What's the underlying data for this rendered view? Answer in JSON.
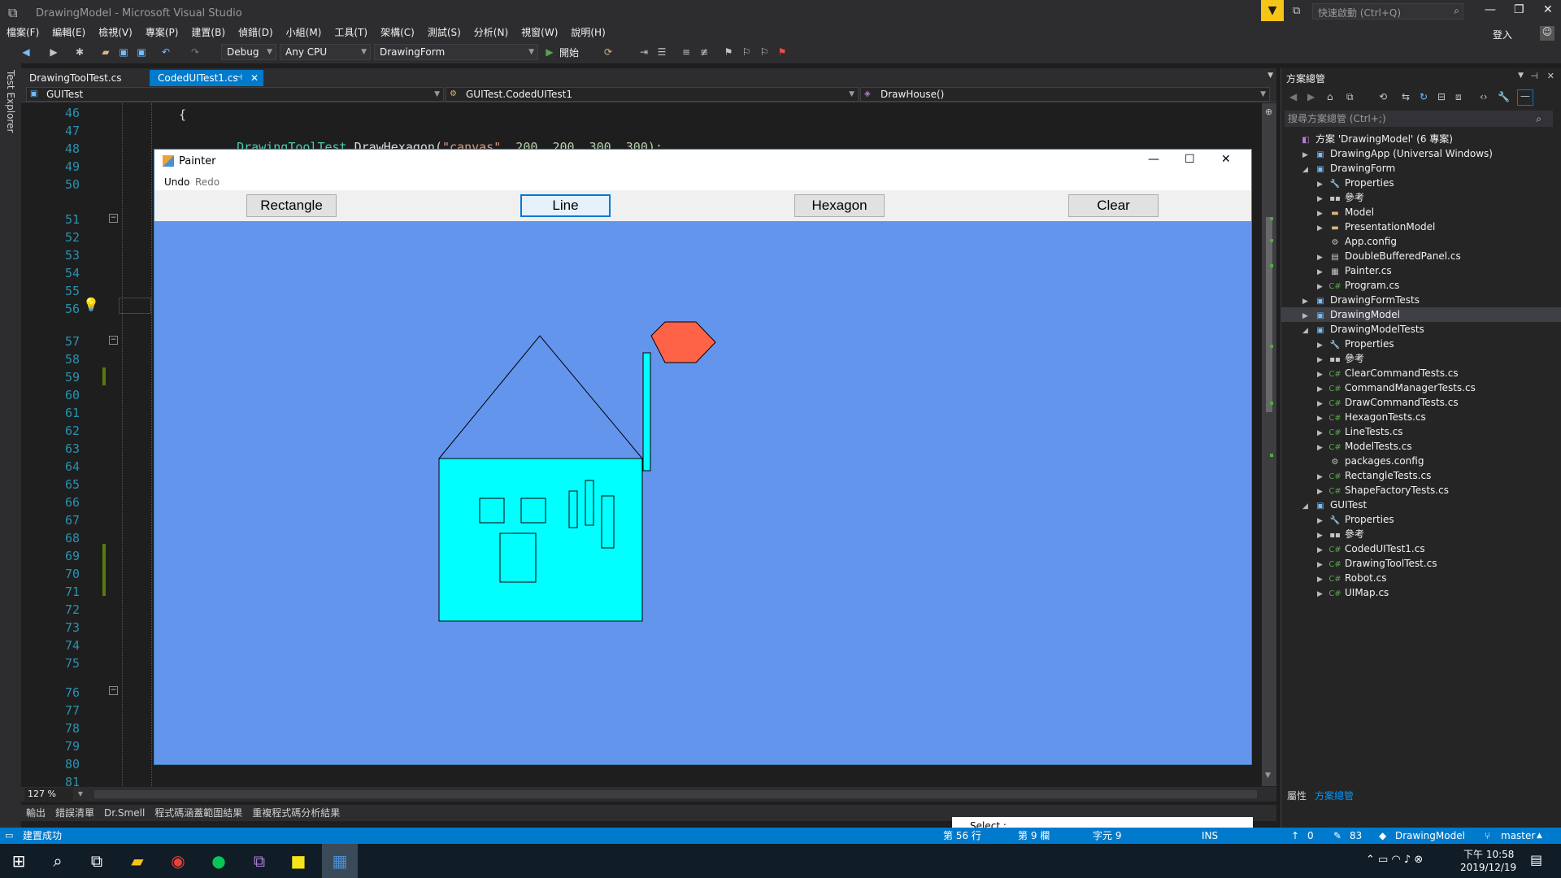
{
  "window": {
    "title": "DrawingModel - Microsoft Visual Studio",
    "quick_launch_placeholder": "快速啟動 (Ctrl+Q)",
    "signin": "登入"
  },
  "menu": [
    "檔案(F)",
    "編輯(E)",
    "檢視(V)",
    "專案(P)",
    "建置(B)",
    "偵錯(D)",
    "小組(M)",
    "工具(T)",
    "架構(C)",
    "測試(S)",
    "分析(N)",
    "視窗(W)",
    "說明(H)"
  ],
  "toolbar": {
    "config": "Debug",
    "platform": "Any CPU",
    "startup": "DrawingForm",
    "start_label": "開始"
  },
  "leftstrip": {
    "label": "Test Explorer"
  },
  "tabs": [
    {
      "label": "DrawingToolTest.cs"
    },
    {
      "label": "CodedUITest1.cs"
    }
  ],
  "nav": {
    "project": "GUITest",
    "class": "GUITest.CodedUITest1",
    "member": "DrawHouse()"
  },
  "editor": {
    "line_numbers": [
      "46",
      "47",
      "48",
      "49",
      "50",
      "51",
      "52",
      "53",
      "54",
      "55",
      "56",
      "57",
      "58",
      "59",
      "60",
      "61",
      "62",
      "63",
      "64",
      "65",
      "66",
      "67",
      "68",
      "69",
      "70",
      "71",
      "72",
      "73",
      "74",
      "75",
      "76",
      "77",
      "78",
      "79",
      "80",
      "81"
    ],
    "code": {
      "brace": "{",
      "class_name": "DrawingToolTest",
      "method_call": ".DrawHexagon(",
      "arg_string": "\"canvas\"",
      "args_rest": ", 200, 200, 300, 300);"
    },
    "zoom": "127 %"
  },
  "bottom_tabs": [
    "輸出",
    "錯誤清單",
    "Dr.Smell",
    "程式碼涵蓋範圍結果",
    "重複程式碼分析結果"
  ],
  "painter": {
    "title": "Painter",
    "menu": {
      "undo": "Undo",
      "redo": "Redo"
    },
    "buttons": [
      "Rectangle",
      "Line",
      "Hexagon",
      "Clear"
    ],
    "canvas_color": "#6495ed",
    "status_label": "Select :"
  },
  "solution": {
    "title": "方案總管",
    "search_placeholder": "搜尋方案總管 (Ctrl+;)",
    "items": [
      {
        "label": "方案 'DrawingModel' (6 專案)",
        "level": 0,
        "exp": "",
        "icon": "solution"
      },
      {
        "label": "DrawingApp (Universal Windows)",
        "level": 1,
        "exp": "▶",
        "icon": "project"
      },
      {
        "label": "DrawingForm",
        "level": 1,
        "exp": "◢",
        "icon": "project"
      },
      {
        "label": "Properties",
        "level": 2,
        "exp": "▶",
        "icon": "wrench"
      },
      {
        "label": "參考",
        "level": 2,
        "exp": "▶",
        "icon": "refs"
      },
      {
        "label": "Model",
        "level": 2,
        "exp": "▶",
        "icon": "folder"
      },
      {
        "label": "PresentationModel",
        "level": 2,
        "exp": "▶",
        "icon": "folder"
      },
      {
        "label": "App.config",
        "level": 2,
        "exp": "",
        "icon": "config"
      },
      {
        "label": "DoubleBufferedPanel.cs",
        "level": 2,
        "exp": "▶",
        "icon": "file"
      },
      {
        "label": "Painter.cs",
        "level": 2,
        "exp": "▶",
        "icon": "form"
      },
      {
        "label": "Program.cs",
        "level": 2,
        "exp": "▶",
        "icon": "cs"
      },
      {
        "label": "DrawingFormTests",
        "level": 1,
        "exp": "▶",
        "icon": "project"
      },
      {
        "label": "DrawingModel",
        "level": 1,
        "exp": "▶",
        "icon": "project"
      },
      {
        "label": "DrawingModelTests",
        "level": 1,
        "exp": "◢",
        "icon": "project"
      },
      {
        "label": "Properties",
        "level": 2,
        "exp": "▶",
        "icon": "wrench"
      },
      {
        "label": "參考",
        "level": 2,
        "exp": "▶",
        "icon": "refs"
      },
      {
        "label": "ClearCommandTests.cs",
        "level": 2,
        "exp": "▶",
        "icon": "cs"
      },
      {
        "label": "CommandManagerTests.cs",
        "level": 2,
        "exp": "▶",
        "icon": "cs"
      },
      {
        "label": "DrawCommandTests.cs",
        "level": 2,
        "exp": "▶",
        "icon": "cs"
      },
      {
        "label": "HexagonTests.cs",
        "level": 2,
        "exp": "▶",
        "icon": "cs"
      },
      {
        "label": "LineTests.cs",
        "level": 2,
        "exp": "▶",
        "icon": "cs"
      },
      {
        "label": "ModelTests.cs",
        "level": 2,
        "exp": "▶",
        "icon": "cs"
      },
      {
        "label": "packages.config",
        "level": 2,
        "exp": "",
        "icon": "config"
      },
      {
        "label": "RectangleTests.cs",
        "level": 2,
        "exp": "▶",
        "icon": "cs"
      },
      {
        "label": "ShapeFactoryTests.cs",
        "level": 2,
        "exp": "▶",
        "icon": "cs"
      },
      {
        "label": "GUITest",
        "level": 1,
        "exp": "◢",
        "icon": "project"
      },
      {
        "label": "Properties",
        "level": 2,
        "exp": "▶",
        "icon": "wrench"
      },
      {
        "label": "參考",
        "level": 2,
        "exp": "▶",
        "icon": "refs"
      },
      {
        "label": "CodedUITest1.cs",
        "level": 2,
        "exp": "▶",
        "icon": "cs"
      },
      {
        "label": "DrawingToolTest.cs",
        "level": 2,
        "exp": "▶",
        "icon": "cs"
      },
      {
        "label": "Robot.cs",
        "level": 2,
        "exp": "▶",
        "icon": "cs"
      },
      {
        "label": "UIMap.cs",
        "level": 2,
        "exp": "▶",
        "icon": "cs"
      }
    ],
    "bottom_tabs": [
      "屬性",
      "方案總管"
    ]
  },
  "status": {
    "message": "建置成功",
    "line": "第 56 行",
    "col": "第 9 欄",
    "ch": "字元 9",
    "ins": "INS",
    "pushes": "0",
    "changes": "83",
    "repo": "DrawingModel",
    "branch": "master"
  },
  "taskbar": {
    "time": "下午 10:58",
    "date": "2019/12/19"
  }
}
